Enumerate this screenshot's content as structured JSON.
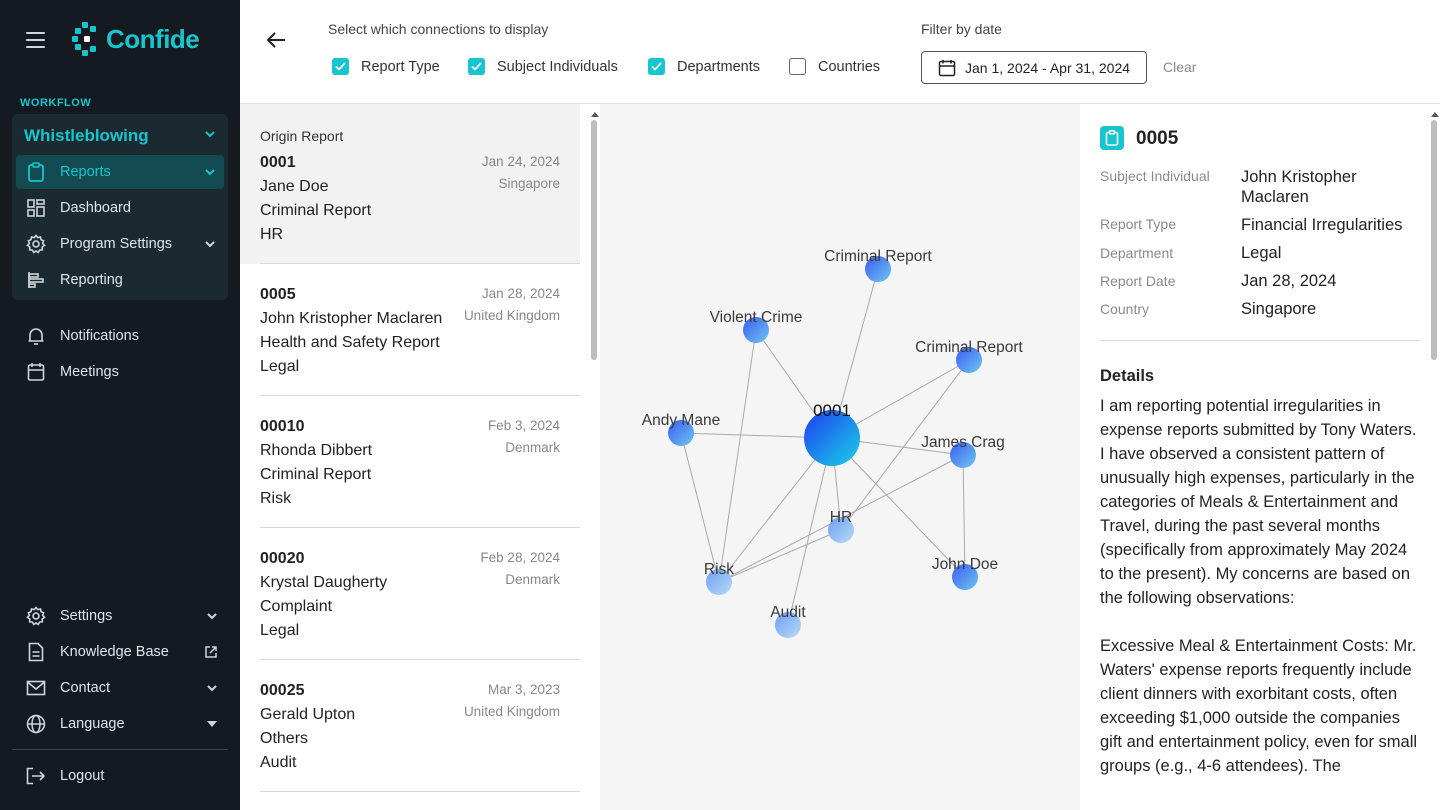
{
  "app": {
    "name": "Confide",
    "brand_color": "#17c5cf",
    "sidebar_bg": "#141a1f"
  },
  "sidebar": {
    "section_label": "WORKFLOW",
    "workflow_title": "Whistleblowing",
    "workflow_items": [
      {
        "label": "Reports",
        "icon": "clipboard-icon",
        "active": true
      },
      {
        "label": "Dashboard",
        "icon": "dashboard-icon"
      },
      {
        "label": "Program Settings",
        "icon": "gear-icon"
      },
      {
        "label": "Reporting",
        "icon": "reporting-icon"
      }
    ],
    "items": [
      {
        "label": "Notifications",
        "icon": "bell-icon"
      },
      {
        "label": "Meetings",
        "icon": "calendar-icon"
      }
    ],
    "bottom_items": [
      {
        "label": "Settings",
        "icon": "gear-icon"
      },
      {
        "label": "Knowledge Base",
        "icon": "document-icon"
      },
      {
        "label": "Contact",
        "icon": "mail-icon"
      },
      {
        "label": "Language",
        "icon": "globe-icon"
      }
    ],
    "logout": "Logout"
  },
  "topbar": {
    "connections_label": "Select which connections to display",
    "checkboxes": [
      {
        "label": "Report Type",
        "checked": true
      },
      {
        "label": "Subject Individuals",
        "checked": true
      },
      {
        "label": "Departments",
        "checked": true
      },
      {
        "label": "Countries",
        "checked": false
      }
    ],
    "date_label": "Filter by date",
    "date_range": "Jan 1, 2024 - Apr 31, 2024",
    "clear": "Clear"
  },
  "reports": {
    "origin_label": "Origin Report",
    "items": [
      {
        "id": "0001",
        "name": "Jane Doe",
        "type": "Criminal Report",
        "department": "HR",
        "date": "Jan 24, 2024",
        "country": "Singapore",
        "selected": true
      },
      {
        "id": "0005",
        "name": "John Kristopher Maclaren",
        "type": "Health and Safety Report",
        "department": "Legal",
        "date": "Jan 28, 2024",
        "country": "United Kingdom"
      },
      {
        "id": "00010",
        "name": "Rhonda Dibbert",
        "type": "Criminal Report",
        "department": "Risk",
        "date": "Feb 3, 2024",
        "country": "Denmark"
      },
      {
        "id": "00020",
        "name": "Krystal Daugherty",
        "type": "Complaint",
        "department": "Legal",
        "date": "Feb 28, 2024",
        "country": "Denmark"
      },
      {
        "id": "00025",
        "name": "Gerald Upton",
        "type": "Others",
        "department": "Audit",
        "date": "Mar 3, 2023",
        "country": "United Kingdom"
      }
    ]
  },
  "graph": {
    "center": "0001",
    "nodes": [
      "Criminal Report",
      "Violent Crime",
      "Criminal Report",
      "Andy Mane",
      "James Crag",
      "HR",
      "John Doe",
      "Risk",
      "Audit"
    ]
  },
  "detail": {
    "id": "0005",
    "fields": [
      {
        "label": "Subject Individual",
        "value": "John Kristopher Maclaren"
      },
      {
        "label": "Report Type",
        "value": "Financial Irregularities"
      },
      {
        "label": "Department",
        "value": "Legal"
      },
      {
        "label": "Report Date",
        "value": "Jan 28, 2024"
      },
      {
        "label": "Country",
        "value": "Singapore"
      }
    ],
    "details_title": "Details",
    "details_text": "I am reporting potential irregularities in expense  reports submitted by Tony Waters. I have observed a consistent pattern  of unusually high expenses, particularly in the categories of Meals  & Entertainment and Travel, during the past several months  (specifically from approximately May 2024 to the present). My concerns are based on the following observations:\n\nExcessive Meal & Entertainment Costs: Mr. Waters' expense reports frequently include client dinners with  exorbitant costs, often exceeding $1,000 outside the companies gift and  entertainment policy, even for small groups (e.g., 4-6 attendees). The"
  }
}
